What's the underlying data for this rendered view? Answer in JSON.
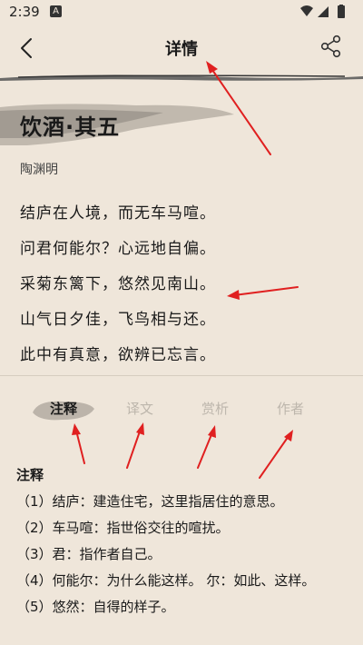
{
  "status_bar": {
    "time": "2:39",
    "notification_letter": "A"
  },
  "header": {
    "title": "详情"
  },
  "poem": {
    "title": "饮酒·其五",
    "author": "陶渊明",
    "lines": [
      "结庐在人境，而无车马喧。",
      "问君何能尔？心远地自偏。",
      "采菊东篱下，悠然见南山。",
      "山气日夕佳，飞鸟相与还。",
      "此中有真意，欲辨已忘言。"
    ]
  },
  "tabs": [
    {
      "label": "注释",
      "active": true
    },
    {
      "label": "译文",
      "active": false
    },
    {
      "label": "赏析",
      "active": false
    },
    {
      "label": "作者",
      "active": false
    }
  ],
  "notes": {
    "heading": "注释",
    "items": [
      "（1）结庐：建造住宅，这里指居住的意思。",
      "（2）车马喧：指世俗交往的喧扰。",
      "（3）君：指作者自己。",
      "（4）何能尔：为什么能这样。 尔：如此、这样。",
      "（5）悠然：自得的样子。"
    ]
  },
  "colors": {
    "background": "#efe6da",
    "annotation_arrow": "#e02020",
    "inactive_tab": "#bdb6ac"
  },
  "icons": [
    "back-arrow-icon",
    "share-icon",
    "wifi-icon",
    "signal-icon",
    "battery-icon"
  ]
}
